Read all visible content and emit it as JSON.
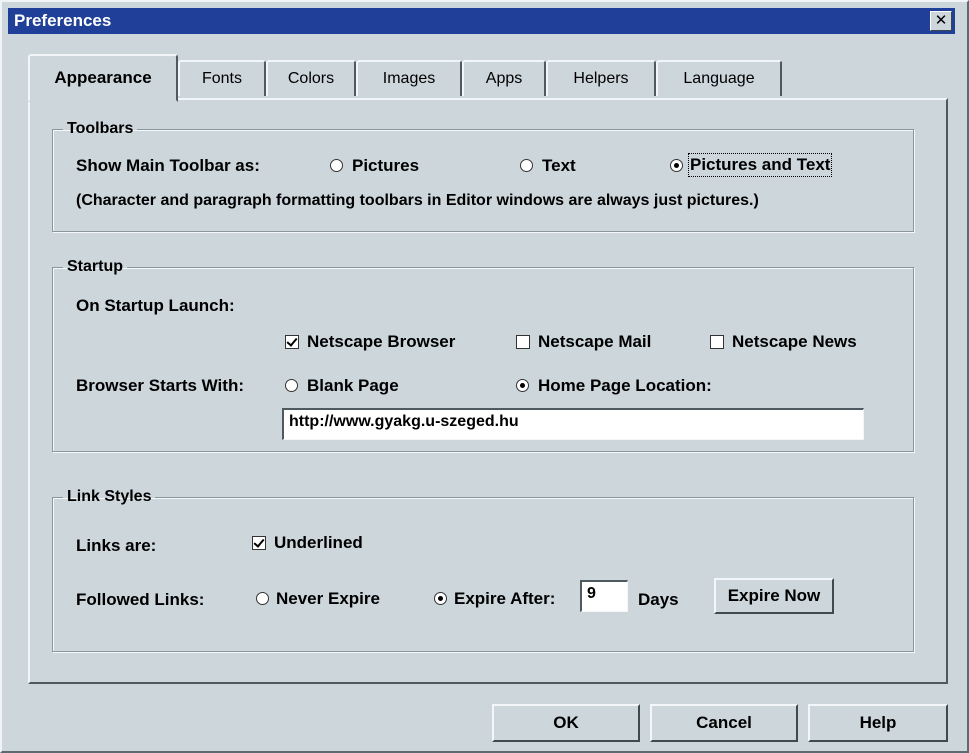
{
  "window": {
    "title": "Preferences",
    "close_glyph": "✕"
  },
  "tabs": [
    {
      "label": "Appearance",
      "active": true
    },
    {
      "label": "Fonts",
      "active": false
    },
    {
      "label": "Colors",
      "active": false
    },
    {
      "label": "Images",
      "active": false
    },
    {
      "label": "Apps",
      "active": false
    },
    {
      "label": "Helpers",
      "active": false
    },
    {
      "label": "Language",
      "active": false
    }
  ],
  "toolbars": {
    "legend": "Toolbars",
    "show_label": "Show Main Toolbar as:",
    "options": [
      {
        "label": "Pictures",
        "checked": false
      },
      {
        "label": "Text",
        "checked": false
      },
      {
        "label": "Pictures and Text",
        "checked": true
      }
    ],
    "note": "(Character and paragraph formatting toolbars in Editor windows are always just pictures.)"
  },
  "startup": {
    "legend": "Startup",
    "launch_label": "On Startup Launch:",
    "launch_options": [
      {
        "label": "Netscape Browser",
        "checked": true
      },
      {
        "label": "Netscape Mail",
        "checked": false
      },
      {
        "label": "Netscape News",
        "checked": false
      }
    ],
    "starts_with_label": "Browser Starts With:",
    "starts_options": [
      {
        "label": "Blank Page",
        "checked": false
      },
      {
        "label": "Home Page Location:",
        "checked": true
      }
    ],
    "home_url": "http://www.gyakg.u-szeged.hu"
  },
  "links": {
    "legend": "Link Styles",
    "links_are_label": "Links are:",
    "underlined_label": "Underlined",
    "underlined_checked": true,
    "followed_label": "Followed Links:",
    "never_expire_label": "Never Expire",
    "never_expire_checked": false,
    "expire_after_label": "Expire After:",
    "expire_after_checked": true,
    "expire_days": "9",
    "days_label": "Days",
    "expire_now_label": "Expire Now"
  },
  "buttons": {
    "ok": "OK",
    "cancel": "Cancel",
    "help": "Help"
  }
}
